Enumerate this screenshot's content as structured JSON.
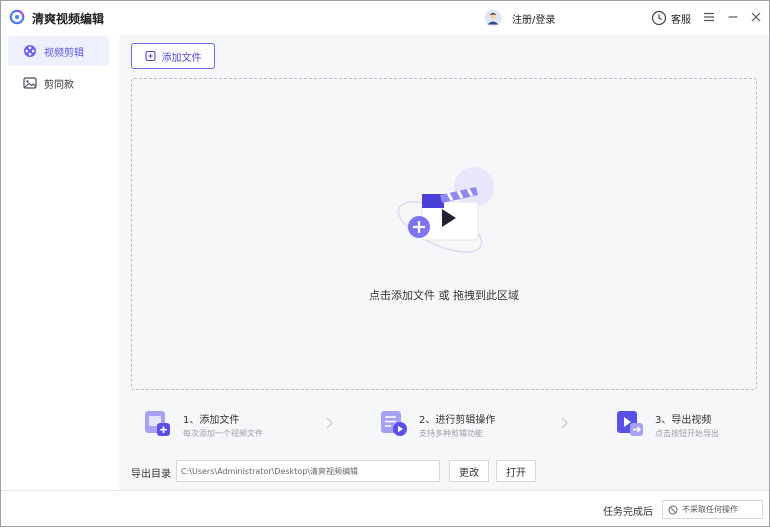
{
  "app": {
    "title": "清爽视频编辑"
  },
  "header": {
    "login_label": "注册/登录",
    "service_label": "客服"
  },
  "sidebar": {
    "items": [
      {
        "label": "视频剪辑",
        "active": true
      },
      {
        "label": "剪同款",
        "active": false
      }
    ]
  },
  "toolbar": {
    "add_file_label": "添加文件"
  },
  "dropzone": {
    "text": "点击添加文件 或 拖拽到此区域"
  },
  "steps": [
    {
      "title": "1、添加文件",
      "desc": "每次添加一个视频文件"
    },
    {
      "title": "2、进行剪辑操作",
      "desc": "支持多种剪辑功能"
    },
    {
      "title": "3、导出视频",
      "desc": "点击按钮开始导出"
    }
  ],
  "export": {
    "label": "导出目录",
    "path": "C:\\Users\\Administrator\\Desktop\\清爽视频编辑",
    "change_label": "更改",
    "open_label": "打开"
  },
  "footer": {
    "after_task_label": "任务完成后",
    "after_task_value": "不采取任何操作"
  },
  "colors": {
    "accent": "#5a56e6",
    "accent_light": "#eef0fe",
    "background": "#f6f7f9"
  }
}
